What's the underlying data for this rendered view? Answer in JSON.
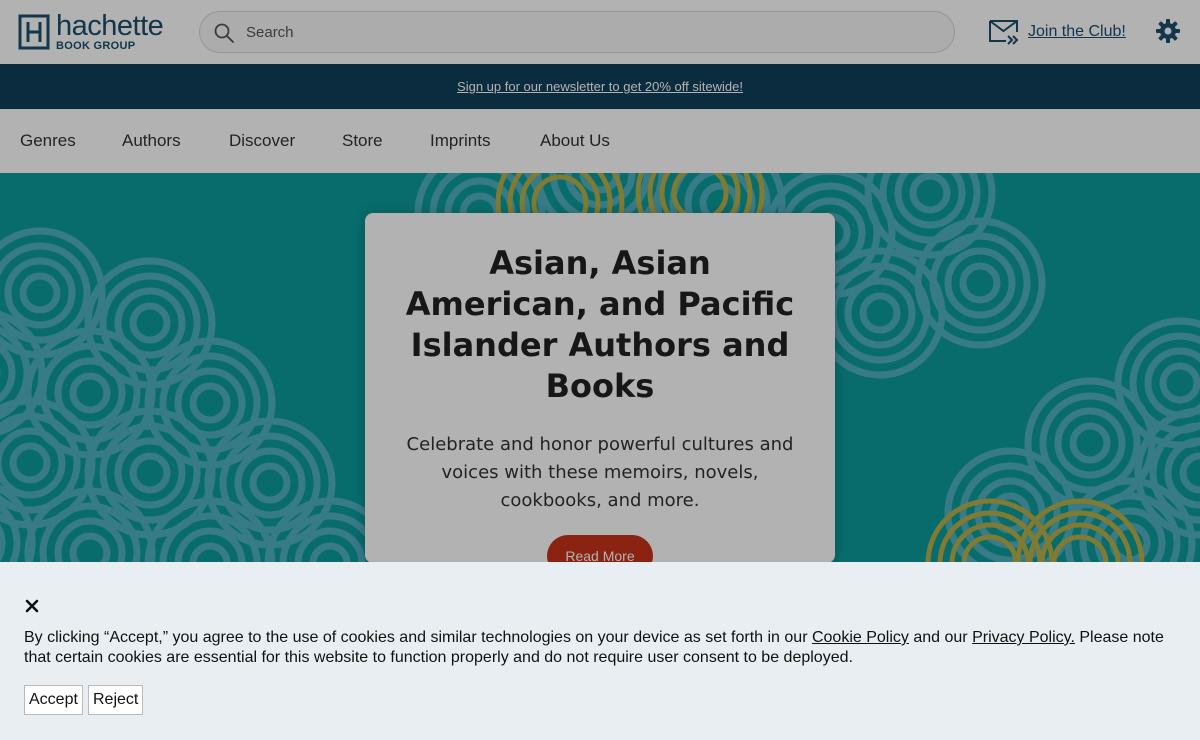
{
  "header": {
    "logo_word": "hachette",
    "logo_sub": "BOOK GROUP",
    "search_placeholder": "Search",
    "join_label": "Join the Club!"
  },
  "promo": {
    "text": "Sign up for our newsletter to get 20% off sitewide!"
  },
  "nav": {
    "items": [
      "Genres",
      "Authors",
      "Discover",
      "Store",
      "Imprints",
      "About Us"
    ]
  },
  "hero": {
    "title": "Asian, Asian American, and Pacific Islander Authors and Books",
    "description": "Celebrate and honor powerful cultures and voices with these memoirs, novels, cookbooks, and more.",
    "button_label": "Read More"
  },
  "cookie": {
    "text_before": "By clicking “Accept,” you agree to the use of cookies and similar technologies on your device as set forth in our ",
    "cookie_policy_link": "Cookie Policy",
    "text_middle": " and our ",
    "privacy_policy_link": "Privacy Policy.",
    "text_after": " Please note that certain cookies are essential for this website to function properly and do not require user consent to be deployed.",
    "accept_label": "Accept",
    "reject_label": "Reject"
  },
  "colors": {
    "brand": "#1b4e6b",
    "promo_bar": "#113f5a",
    "hero_bg": "#0e9c9c",
    "pattern": "#5bb6c9",
    "pattern_accent": "#d6b53a",
    "cta": "#c6331b",
    "cookie_bg": "#e8eef1"
  },
  "icons": {
    "logo": "hachette-h-logo-icon",
    "search": "search-icon",
    "mail": "mail-icon",
    "settings": "gear-icon",
    "close": "close-icon"
  }
}
